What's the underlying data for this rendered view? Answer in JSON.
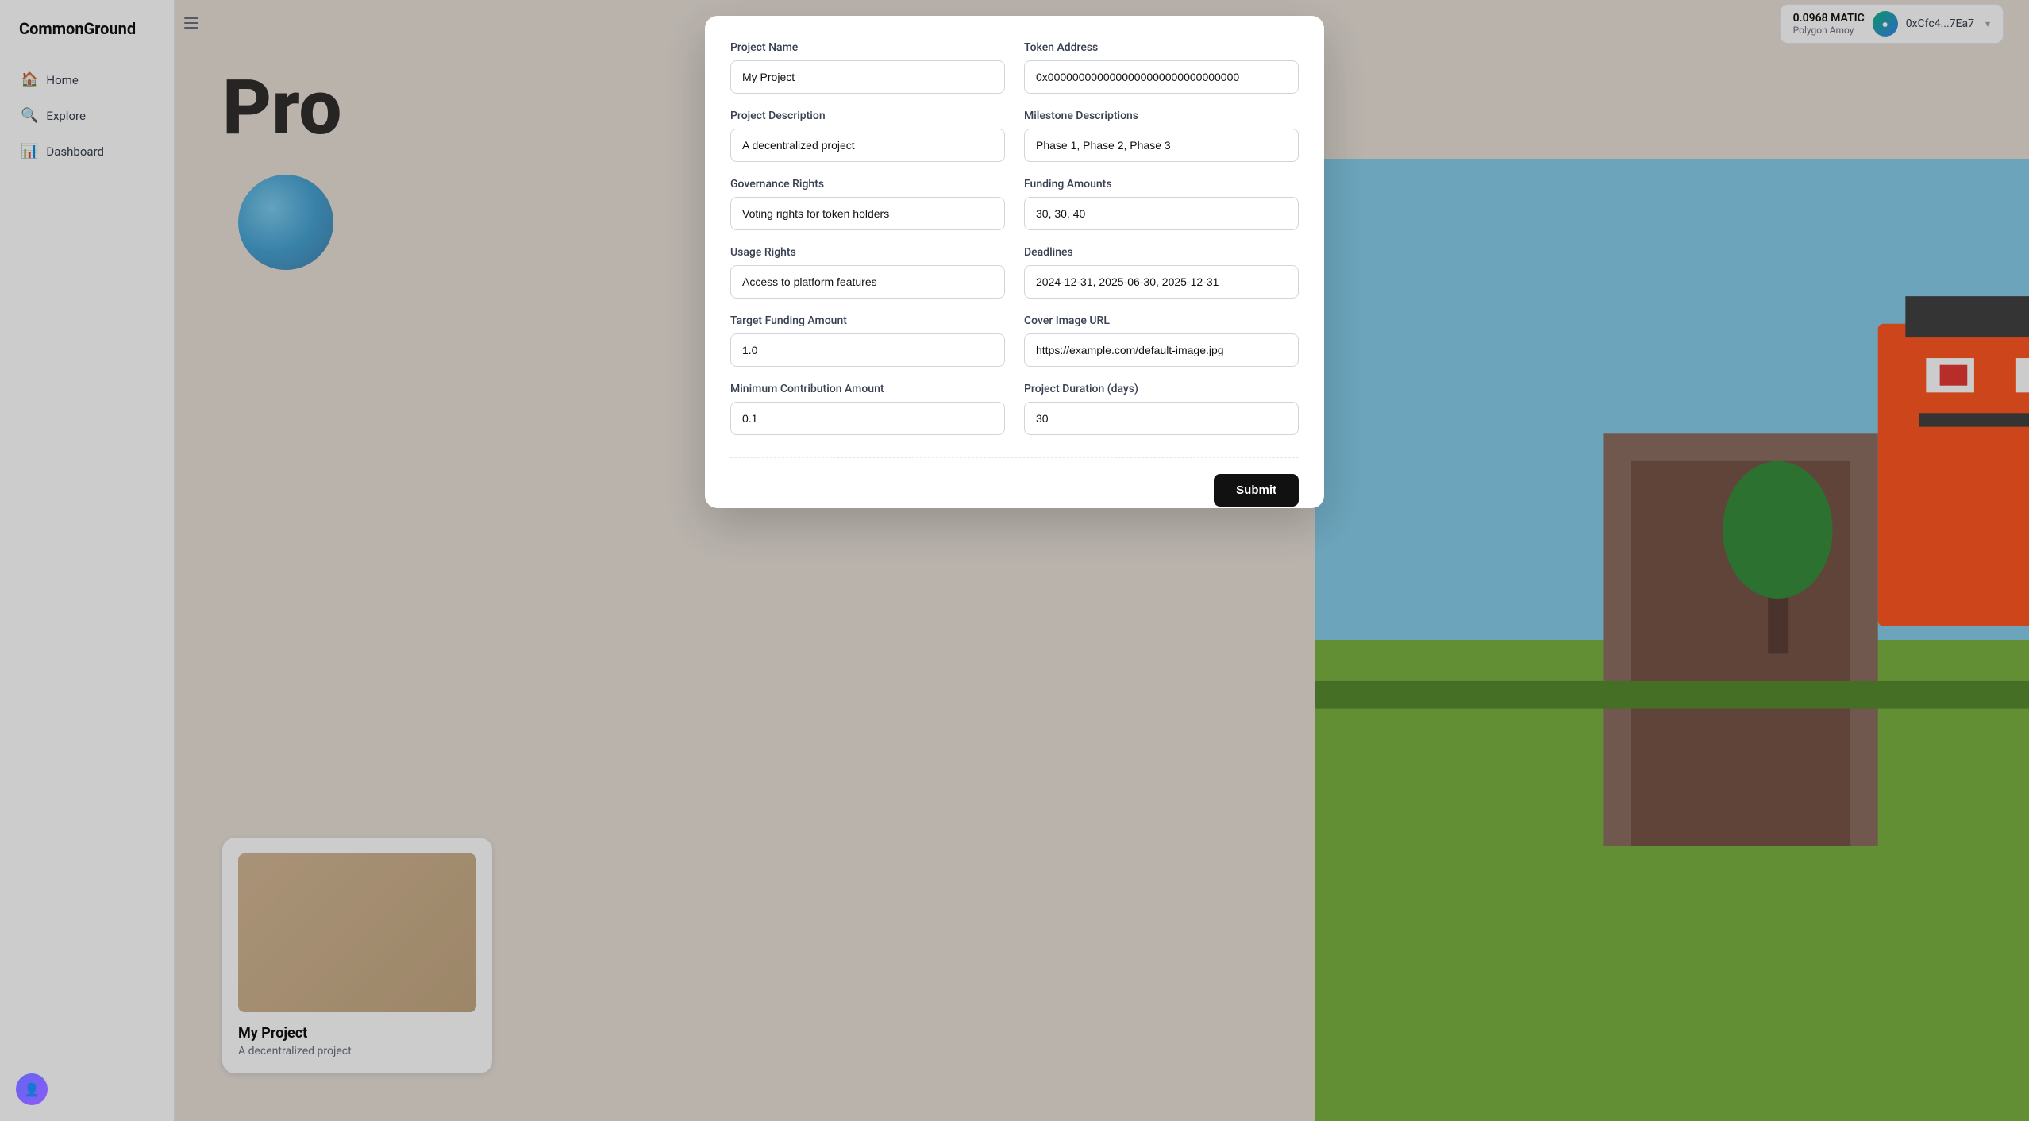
{
  "app": {
    "name": "CommonGround"
  },
  "sidebar": {
    "items": [
      {
        "id": "home",
        "label": "Home",
        "icon": "🏠"
      },
      {
        "id": "explore",
        "label": "Explore",
        "icon": "🔍"
      },
      {
        "id": "dashboard",
        "label": "Dashboard",
        "icon": "📊"
      }
    ]
  },
  "sidebar_toggle": {
    "icon": "⬛"
  },
  "header": {
    "wallet": {
      "amount": "0.0968 MATIC",
      "network": "Polygon Amoy",
      "address": "0xCfc4...7Ea7"
    }
  },
  "page": {
    "title": "Pro"
  },
  "modal": {
    "fields": [
      {
        "id": "project-name",
        "label": "Project Name",
        "value": "My Project",
        "placeholder": "Project Name"
      },
      {
        "id": "token-address",
        "label": "Token Address",
        "value": "0x0000000000000000000000000000000",
        "placeholder": "Token Address"
      },
      {
        "id": "project-description",
        "label": "Project Description",
        "value": "A decentralized project",
        "placeholder": "Project Description"
      },
      {
        "id": "milestone-descriptions",
        "label": "Milestone Descriptions",
        "value": "Phase 1, Phase 2, Phase 3",
        "placeholder": "Milestone Descriptions"
      },
      {
        "id": "governance-rights",
        "label": "Governance Rights",
        "value": "Voting rights for token holders",
        "placeholder": "Governance Rights"
      },
      {
        "id": "funding-amounts",
        "label": "Funding Amounts",
        "value": "30, 30, 40",
        "placeholder": "Funding Amounts"
      },
      {
        "id": "usage-rights",
        "label": "Usage Rights",
        "value": "Access to platform features",
        "placeholder": "Usage Rights"
      },
      {
        "id": "deadlines",
        "label": "Deadlines",
        "value": "2024-12-31, 2025-06-30, 2025-12-31",
        "placeholder": "Deadlines"
      },
      {
        "id": "target-funding-amount",
        "label": "Target Funding Amount",
        "value": "1.0",
        "placeholder": "Target Funding Amount"
      },
      {
        "id": "cover-image-url",
        "label": "Cover Image URL",
        "value": "https://example.com/default-image.jpg",
        "placeholder": "Cover Image URL"
      },
      {
        "id": "minimum-contribution-amount",
        "label": "Minimum Contribution Amount",
        "value": "0.1",
        "placeholder": "Minimum Contribution Amount"
      },
      {
        "id": "project-duration",
        "label": "Project Duration (days)",
        "value": "30",
        "placeholder": "Project Duration (days)"
      }
    ],
    "submit_label": "Submit"
  },
  "project_card": {
    "title": "My Project",
    "description": "A decentralized project"
  }
}
